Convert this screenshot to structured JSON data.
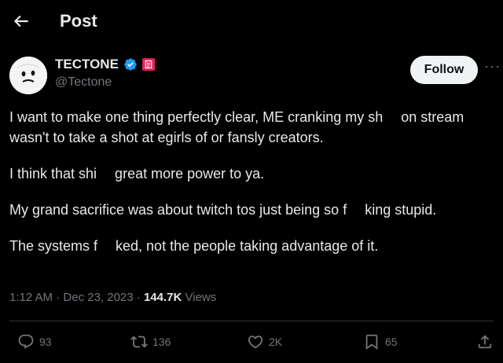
{
  "header": {
    "title": "Post"
  },
  "author": {
    "display_name": "TECTONE",
    "handle": "@Tectone",
    "verified": true
  },
  "follow_label": "Follow",
  "tweet": {
    "paragraphs": [
      "I want to make one thing perfectly clear, ME cranking my sh  on stream wasn't to take a shot at egirls of or fansly creators.",
      "I think that shi  great more power to ya.",
      "My grand sacrifice was about twitch tos just being so f  king stupid.",
      "The systems f  ked, not the people taking advantage of it."
    ]
  },
  "meta": {
    "time": "1:12 AM",
    "date": "Dec 23, 2023",
    "views_count": "144.7K",
    "views_label": "Views"
  },
  "actions": {
    "replies": "93",
    "reposts": "136",
    "likes": "2K",
    "bookmarks": "65"
  },
  "colors": {
    "background": "#000000",
    "text": "#e7e9ea",
    "muted": "#71767b",
    "verified": "#1d9bf0",
    "affiliate": "#e0245e",
    "divider": "#2f3336"
  }
}
